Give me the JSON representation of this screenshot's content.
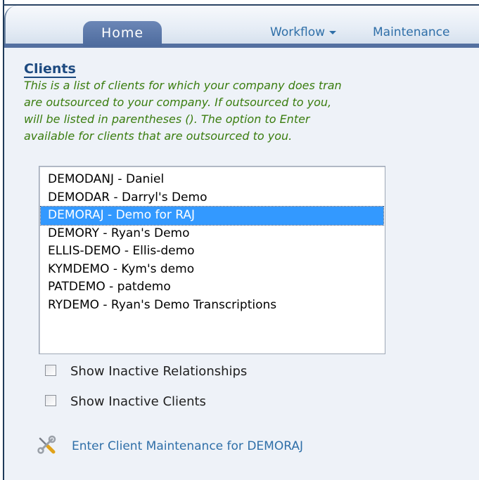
{
  "nav": {
    "home_label": "Home",
    "workflow_label": "Workflow",
    "maintenance_label": "Maintenance"
  },
  "clients": {
    "title": "Clients",
    "description_lines": [
      "This is a list of clients for which your company does tran",
      "are outsourced to your company. If outsourced to you,",
      "will be listed in parentheses (). The option to Enter",
      "available for clients that are outsourced to you."
    ],
    "list": {
      "items": [
        "DEMODANJ - Daniel",
        "DEMODAR - Darryl's Demo",
        "DEMORAJ - Demo for RAJ",
        "DEMORY - Ryan's Demo",
        "ELLIS-DEMO - Ellis-demo",
        "KYMDEMO - Kym's demo",
        "PATDEMO - patdemo",
        "RYDEMO - Ryan's Demo Transcriptions"
      ],
      "selected_index": 2
    },
    "show_inactive_relationships_label": "Show Inactive Relationships",
    "show_inactive_clients_label": "Show Inactive Clients",
    "enter_maintenance_label": "Enter Client Maintenance for DEMORAJ",
    "icons": {
      "maintenance": "tools-icon",
      "workflow_dropdown": "chevron-down-icon"
    }
  },
  "colors": {
    "tab_active": "#5572a4",
    "link": "#2f6fa8",
    "title": "#1d4a80",
    "description": "#3a7d0f",
    "selection": "#3399ff"
  }
}
